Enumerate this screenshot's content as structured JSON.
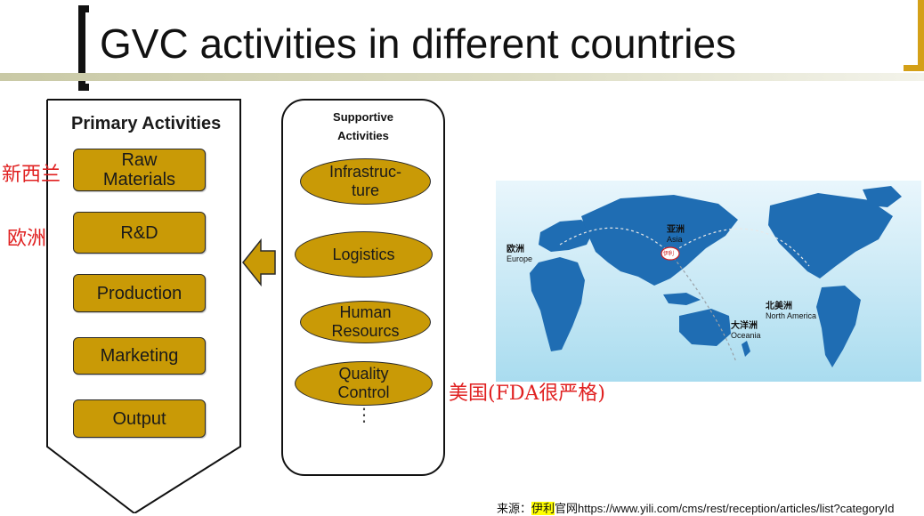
{
  "slide": {
    "title": "GVC activities in different countries",
    "accent_color": "#d4a017"
  },
  "primary": {
    "heading": "Primary Activities",
    "items": [
      {
        "label": "Raw\nMaterials"
      },
      {
        "label": "R&D"
      },
      {
        "label": "Production"
      },
      {
        "label": "Marketing"
      },
      {
        "label": "Output"
      }
    ],
    "fill_color": "#c99a06"
  },
  "supportive": {
    "heading": "Supportive\nActivities",
    "items": [
      {
        "label": "Infrastruc-\nture"
      },
      {
        "label": "Logistics"
      },
      {
        "label": "Human\nResourcs"
      },
      {
        "label": "Quality\nControl"
      }
    ],
    "ellipsis": "⋮"
  },
  "annotations": {
    "raw_materials_country": "新西兰",
    "rd_country": "欧洲",
    "quality_country": "美国(FDA很严格)",
    "color": "#e02020"
  },
  "map": {
    "labels": {
      "europe_cn": "欧洲",
      "europe_en": "Europe",
      "asia_cn": "亚洲",
      "asia_en": "Asia",
      "oceania_cn": "大洋洲",
      "oceania_en": "Oceania",
      "namerica_cn": "北美洲",
      "namerica_en": "North America",
      "logo": "伊利"
    },
    "land_color": "#1f6db3",
    "sea_color": "#c7e8f5"
  },
  "source": {
    "prefix": "来源：",
    "highlight": "伊利",
    "text": "官网https://www.yili.com/cms/rest/reception/articles/list?categoryId"
  }
}
